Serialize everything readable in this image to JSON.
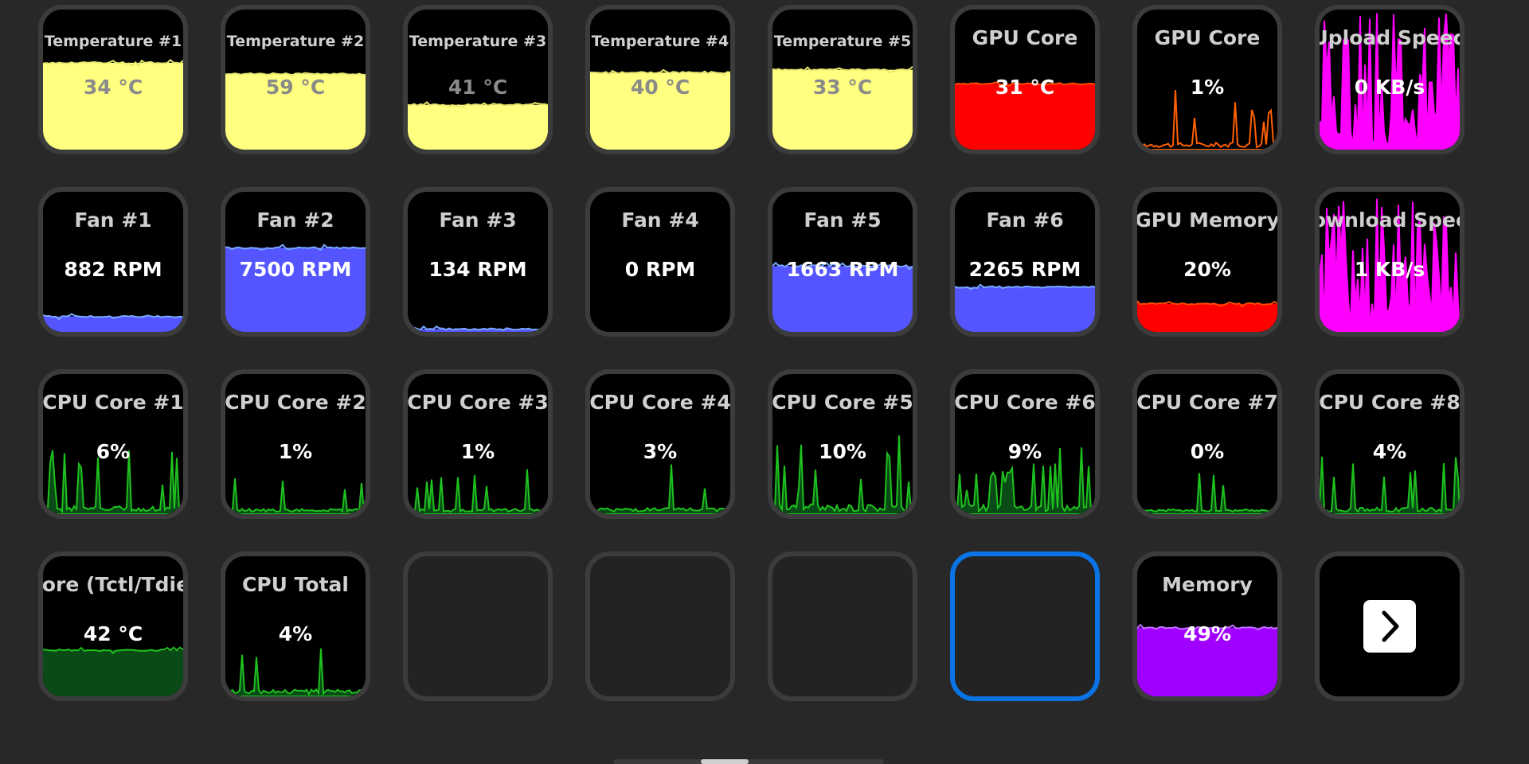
{
  "colors": {
    "temperature": "#ffff80",
    "gpu": "#ff0000",
    "gpu_line": "#ff6000",
    "network": "#ff00ff",
    "fan": "#5555ff",
    "fan_line": "#7aa8ff",
    "cpu_fill": "#0a4a16",
    "cpu_line": "#1ec21e",
    "memory": "#a000ff",
    "selected_border": "#0a74e6"
  },
  "tiles": [
    {
      "title": "Temperature #1",
      "value": "34 °C",
      "kind": "level",
      "level": 0.62,
      "color": "temperature",
      "dim": true,
      "small": true
    },
    {
      "title": "Temperature #2",
      "value": "59 °C",
      "kind": "level",
      "level": 0.54,
      "color": "temperature",
      "dim": true,
      "small": true
    },
    {
      "title": "Temperature #3",
      "value": "41 °C",
      "kind": "level",
      "level": 0.32,
      "color": "temperature",
      "dim": true,
      "small": true
    },
    {
      "title": "Temperature #4",
      "value": "40 °C",
      "kind": "level",
      "level": 0.55,
      "color": "temperature",
      "dim": true,
      "small": true
    },
    {
      "title": "Temperature #5",
      "value": "33 °C",
      "kind": "level",
      "level": 0.57,
      "color": "temperature",
      "dim": true,
      "small": true
    },
    {
      "title": "GPU Core",
      "value": "31 °C",
      "kind": "level",
      "level": 0.47,
      "color": "gpu"
    },
    {
      "title": "GPU Core",
      "value": "1%",
      "kind": "spikes",
      "color": "gpu_line"
    },
    {
      "title": "Upload Speed",
      "value": "0 KB/s",
      "kind": "bars",
      "color": "network"
    },
    {
      "title": "Fan #1",
      "value": "882 RPM",
      "kind": "level",
      "level": 0.11,
      "color": "fan"
    },
    {
      "title": "Fan #2",
      "value": "7500 RPM",
      "kind": "level",
      "level": 0.6,
      "color": "fan"
    },
    {
      "title": "Fan #3",
      "value": "134 RPM",
      "kind": "level",
      "level": 0.02,
      "color": "fan"
    },
    {
      "title": "Fan #4",
      "value": "0 RPM",
      "kind": "level",
      "level": 0.0,
      "color": "fan"
    },
    {
      "title": "Fan #5",
      "value": "1663 RPM",
      "kind": "level",
      "level": 0.47,
      "color": "fan"
    },
    {
      "title": "Fan #6",
      "value": "2265 RPM",
      "kind": "level",
      "level": 0.32,
      "color": "fan"
    },
    {
      "title": "GPU Memory",
      "value": "20%",
      "kind": "level",
      "level": 0.2,
      "color": "gpu"
    },
    {
      "title": "Download Speed",
      "value": "1 KB/s",
      "kind": "bars",
      "color": "network"
    },
    {
      "title": "CPU Core #1",
      "value": "6%",
      "kind": "cpu"
    },
    {
      "title": "CPU Core #2",
      "value": "1%",
      "kind": "cpu"
    },
    {
      "title": "CPU Core #3",
      "value": "1%",
      "kind": "cpu"
    },
    {
      "title": "CPU Core #4",
      "value": "3%",
      "kind": "cpu"
    },
    {
      "title": "CPU Core #5",
      "value": "10%",
      "kind": "cpu"
    },
    {
      "title": "CPU Core #6",
      "value": "9%",
      "kind": "cpu"
    },
    {
      "title": "CPU Core #7",
      "value": "0%",
      "kind": "cpu"
    },
    {
      "title": "CPU Core #8",
      "value": "4%",
      "kind": "cpu"
    },
    {
      "title": "Core (Tctl/Tdie)",
      "value": "42 °C",
      "kind": "cpu_level",
      "level": 0.33
    },
    {
      "title": "CPU Total",
      "value": "4%",
      "kind": "cpu"
    },
    {
      "title": "",
      "value": "",
      "kind": "empty"
    },
    {
      "title": "",
      "value": "",
      "kind": "empty"
    },
    {
      "title": "",
      "value": "",
      "kind": "empty"
    },
    {
      "title": "",
      "value": "",
      "kind": "empty",
      "selected": true
    },
    {
      "title": "Memory",
      "value": "49%",
      "kind": "level",
      "level": 0.49,
      "color": "memory"
    },
    {
      "title": "",
      "value": "",
      "kind": "next",
      "icon": "chevron-right-icon"
    }
  ]
}
